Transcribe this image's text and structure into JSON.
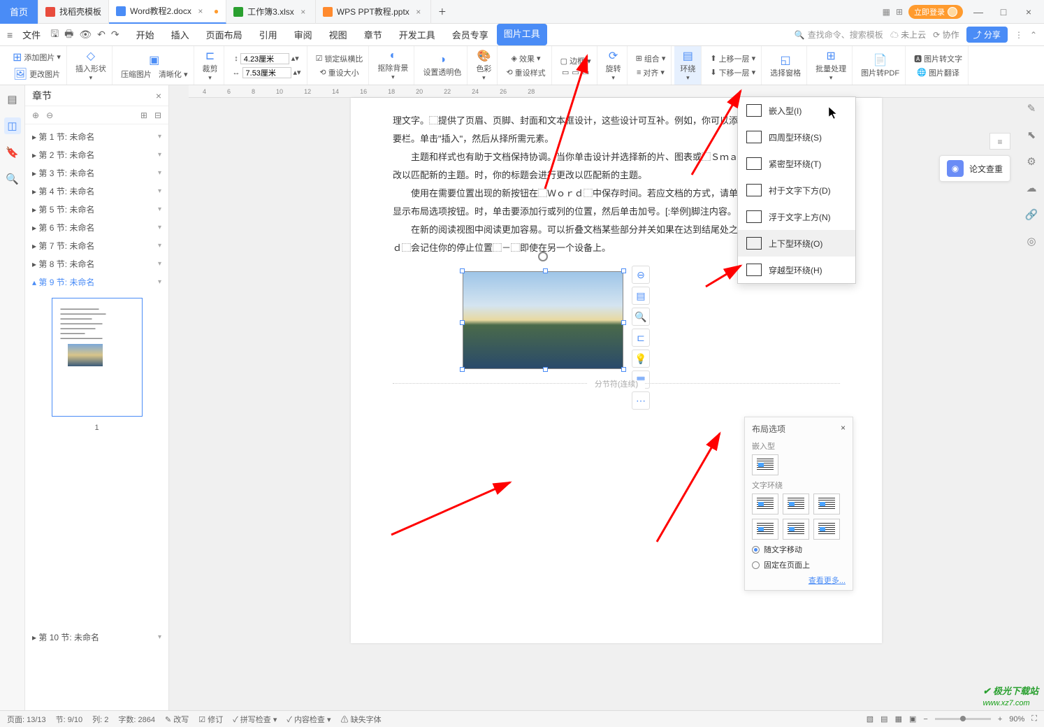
{
  "titlebar": {
    "home": "首页",
    "tabs": [
      {
        "icon": "#e84c3d",
        "label": "找稻壳模板"
      },
      {
        "icon": "#4a8cf6",
        "label": "Word教程2.docx",
        "active": true
      },
      {
        "icon": "#2aa030",
        "label": "工作簿3.xlsx"
      },
      {
        "icon": "#ff8a2e",
        "label": "WPS PPT教程.pptx"
      }
    ],
    "login": "立即登录"
  },
  "menubar": {
    "file": "文件",
    "tabs": [
      "开始",
      "插入",
      "页面布局",
      "引用",
      "审阅",
      "视图",
      "章节",
      "开发工具",
      "会员专享"
    ],
    "active_tab": "图片工具",
    "search_placeholder": "查找命令、搜索模板",
    "cloud": "未上云",
    "collab": "协作",
    "share": "分享"
  },
  "ribbon": {
    "add_image": "添加图片",
    "change_image": "更改图片",
    "insert_shape": "插入形状",
    "compress": "压缩图片",
    "clarity": "清晰化",
    "crop": "裁剪",
    "height_val": "4.23厘米",
    "width_val": "7.53厘米",
    "lock_ratio": "锁定纵横比",
    "reset_size": "重设大小",
    "remove_bg": "抠除背景",
    "transparency": "设置透明色",
    "color": "色彩",
    "effect": "效果",
    "reset_style": "重设样式",
    "border": "边框",
    "rotate": "旋转",
    "combine": "组合",
    "align": "对齐",
    "wrap": "环绕",
    "move_up": "上移一层",
    "move_down": "下移一层",
    "select_pane": "选择窗格",
    "batch": "批量处理",
    "to_pdf": "图片转PDF",
    "img_to_text": "图片转文字",
    "translate": "图片翻译"
  },
  "sidebar": {
    "title": "章节",
    "items": [
      "第 1 节: 未命名",
      "第 2 节: 未命名",
      "第 3 节: 未命名",
      "第 4 节: 未命名",
      "第 5 节: 未命名",
      "第 6 节: 未命名",
      "第 7 节: 未命名",
      "第 8 节: 未命名",
      "第 9 节: 未命名"
    ],
    "active_index": 8,
    "last_item": "第 10 节: 未命名",
    "thumb_num": "1"
  },
  "ruler_marks": [
    "4",
    "6",
    "8",
    "10",
    "12",
    "14",
    "16",
    "18",
    "20",
    "22",
    "24",
    "26",
    "28"
  ],
  "document": {
    "p1": "理文字。⬚提供了页眉、页脚、封面和文本框设计，这些设计可互补。例如，你可以添加匹配的封面、页眉和提要栏。单击\"插入\"，然后从择所需元素。",
    "p2": "主题和样式也有助于文档保持协调。当你单击设计并选择新的片、图表或⬚ＳｍａｒｔＡｒｔ⬚图形将会更改以匹配新的主题。时，你的标题会进行更改以匹配新的主题。",
    "p3": "使用在需要位置出现的新按钮在⬚Ｗｏｒｄ⬚中保存时间。若应文档的方式，请单击该图片，图片旁边将会显示布局选项按钮。时，单击要添加行或列的位置，然后单击加号。[:举例]脚注内容。",
    "p4": "在新的阅读视图中阅读更加容易。可以折叠文档某些部分并关如果在达到结尾处之前需要停止读取，Ｗｏｒｄ⬚会记住你的停止位置⬚－⬚即使在另一个设备上。",
    "section_break": "分节符(连续)"
  },
  "wrap_menu": {
    "items": [
      "嵌入型(I)",
      "四周型环绕(S)",
      "紧密型环绕(T)",
      "衬于文字下方(D)",
      "浮于文字上方(N)",
      "上下型环绕(O)",
      "穿越型环绕(H)"
    ],
    "hover_index": 5
  },
  "layout_panel": {
    "title": "布局选项",
    "sec1": "嵌入型",
    "sec2": "文字环绕",
    "radio1": "随文字移动",
    "radio2": "固定在页面上",
    "more": "查看更多..."
  },
  "essay_check": "论文查重",
  "statusbar": {
    "page": "页面: 13/13",
    "section": "节: 9/10",
    "col": "列: 2",
    "words": "字数: 2864",
    "rewrite": "改写",
    "revise": "修订",
    "spell": "拼写检查",
    "content": "内容检查",
    "missing": "缺失字体",
    "zoom": "90%"
  },
  "watermark": {
    "brand": "极光下载站",
    "url": "www.xz7.com"
  }
}
